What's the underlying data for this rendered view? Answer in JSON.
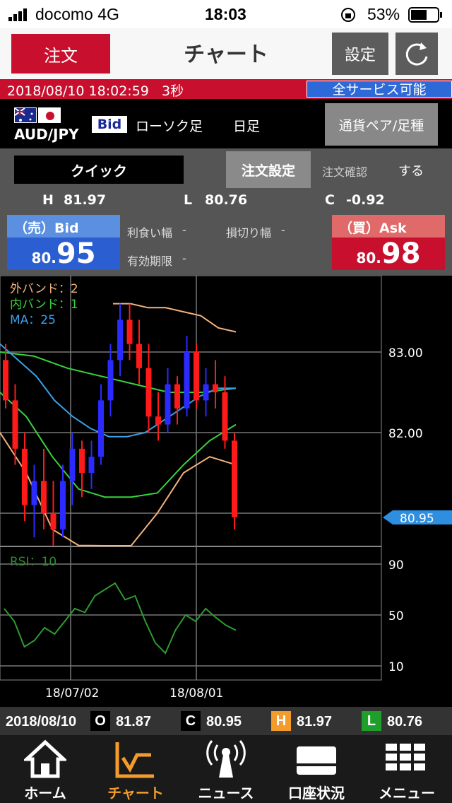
{
  "status": {
    "carrier": "docomo 4G",
    "time": "18:03",
    "battery": "53%"
  },
  "nav": {
    "order_label": "注文",
    "title": "チャート",
    "settings_label": "設定"
  },
  "info": {
    "datetime": "2018/08/10 18:02:59",
    "interval": "3秒",
    "service": "全サービス可能"
  },
  "pair": {
    "name": "AUD/JPY",
    "side": "Bid",
    "chart_type": "ローソク足",
    "period": "日足",
    "pair_button": "通貨ペア/足種"
  },
  "order": {
    "quick": "クイック",
    "order_settings": "注文設定",
    "order_confirm": "注文確認",
    "confirm_value": "する",
    "h_label": "H",
    "h_value": "81.97",
    "l_label": "L",
    "l_value": "80.76",
    "c_label": "C",
    "c_value": "-0.92",
    "sell_label": "（売）Bid",
    "sell_small": "80.",
    "sell_big": "95",
    "buy_label": "（買）Ask",
    "buy_small": "80.",
    "buy_big": "98",
    "take_profit_label": "利食い幅",
    "take_profit_value": "-",
    "stop_loss_label": "損切り幅",
    "stop_loss_value": "-",
    "expiry_label": "有効期限",
    "expiry_value": "-"
  },
  "chart_data": {
    "type": "candlestick",
    "legend": {
      "outer_band": "外バンド：2",
      "inner_band": "内バンド：1",
      "ma": "MA：25",
      "rsi": "RSI：10"
    },
    "y_ticks": [
      "83.00",
      "82.00"
    ],
    "current_price": "80.95",
    "rsi_ticks": [
      "90",
      "50",
      "10"
    ],
    "x_ticks": [
      "18/07/02",
      "18/08/01"
    ],
    "ylim": [
      80.5,
      83.4
    ],
    "candles": [
      {
        "o": 82.9,
        "h": 83.1,
        "l": 82.3,
        "c": 82.4
      },
      {
        "o": 82.4,
        "h": 82.6,
        "l": 81.6,
        "c": 81.8
      },
      {
        "o": 81.8,
        "h": 82.0,
        "l": 80.9,
        "c": 81.1
      },
      {
        "o": 81.1,
        "h": 81.6,
        "l": 80.7,
        "c": 81.4
      },
      {
        "o": 81.4,
        "h": 81.8,
        "l": 80.8,
        "c": 81.0
      },
      {
        "o": 81.0,
        "h": 81.4,
        "l": 80.6,
        "c": 80.8
      },
      {
        "o": 80.8,
        "h": 81.6,
        "l": 80.7,
        "c": 81.4
      },
      {
        "o": 81.4,
        "h": 82.0,
        "l": 81.1,
        "c": 81.8
      },
      {
        "o": 81.8,
        "h": 81.9,
        "l": 81.2,
        "c": 81.5
      },
      {
        "o": 81.5,
        "h": 81.9,
        "l": 81.3,
        "c": 81.7
      },
      {
        "o": 81.7,
        "h": 82.6,
        "l": 81.6,
        "c": 82.4
      },
      {
        "o": 82.4,
        "h": 83.1,
        "l": 82.2,
        "c": 82.9
      },
      {
        "o": 82.9,
        "h": 83.6,
        "l": 82.7,
        "c": 83.4
      },
      {
        "o": 83.4,
        "h": 83.6,
        "l": 82.9,
        "c": 83.1
      },
      {
        "o": 83.1,
        "h": 83.4,
        "l": 82.6,
        "c": 82.8
      },
      {
        "o": 82.8,
        "h": 83.1,
        "l": 82.0,
        "c": 82.2
      },
      {
        "o": 82.2,
        "h": 82.5,
        "l": 81.9,
        "c": 82.1
      },
      {
        "o": 82.1,
        "h": 82.8,
        "l": 82.0,
        "c": 82.6
      },
      {
        "o": 82.6,
        "h": 82.7,
        "l": 82.1,
        "c": 82.3
      },
      {
        "o": 82.3,
        "h": 83.2,
        "l": 82.2,
        "c": 83.0
      },
      {
        "o": 83.0,
        "h": 83.1,
        "l": 82.3,
        "c": 82.4
      },
      {
        "o": 82.4,
        "h": 82.8,
        "l": 82.2,
        "c": 82.6
      },
      {
        "o": 82.6,
        "h": 82.9,
        "l": 82.3,
        "c": 82.5
      },
      {
        "o": 82.5,
        "h": 82.7,
        "l": 81.8,
        "c": 81.9
      },
      {
        "o": 81.9,
        "h": 82.0,
        "l": 80.8,
        "c": 80.95
      }
    ],
    "outer_upper": [
      83.6,
      83.6,
      83.55,
      83.55,
      83.5,
      83.45,
      83.3,
      83.25
    ],
    "inner_upper": [
      83.0,
      82.95,
      82.8,
      82.7,
      82.6,
      82.5,
      82.5,
      82.55
    ],
    "ma": [
      83.1,
      82.9,
      82.7,
      82.4,
      82.2,
      82.05,
      81.95,
      81.95,
      82.0,
      82.15,
      82.3,
      82.45,
      82.55,
      82.55
    ],
    "inner_lower": [
      82.5,
      82.2,
      81.7,
      81.3,
      81.2,
      81.2,
      81.25,
      81.6,
      81.9,
      82.1
    ],
    "outer_lower": [
      82.0,
      81.5,
      80.8,
      80.6,
      80.5,
      80.5,
      81.0,
      81.5,
      81.7,
      81.6
    ],
    "rsi": [
      55,
      45,
      25,
      30,
      40,
      35,
      45,
      55,
      52,
      65,
      70,
      75,
      62,
      65,
      45,
      28,
      20,
      38,
      50,
      45,
      55,
      48,
      42,
      38
    ]
  },
  "ohlc": {
    "date": "2018/08/10",
    "o_label": "O",
    "o_value": "81.87",
    "c_label": "C",
    "c_value": "80.95",
    "h_label": "H",
    "h_value": "81.97",
    "l_label": "L",
    "l_value": "80.76"
  },
  "tabs": [
    {
      "label": "ホーム"
    },
    {
      "label": "チャート"
    },
    {
      "label": "ニュース"
    },
    {
      "label": "口座状況"
    },
    {
      "label": "メニュー"
    }
  ],
  "colors": {
    "accent_red": "#c8102e",
    "active_tab": "#f39c2b",
    "bid_blue": "#2b5fd1"
  }
}
